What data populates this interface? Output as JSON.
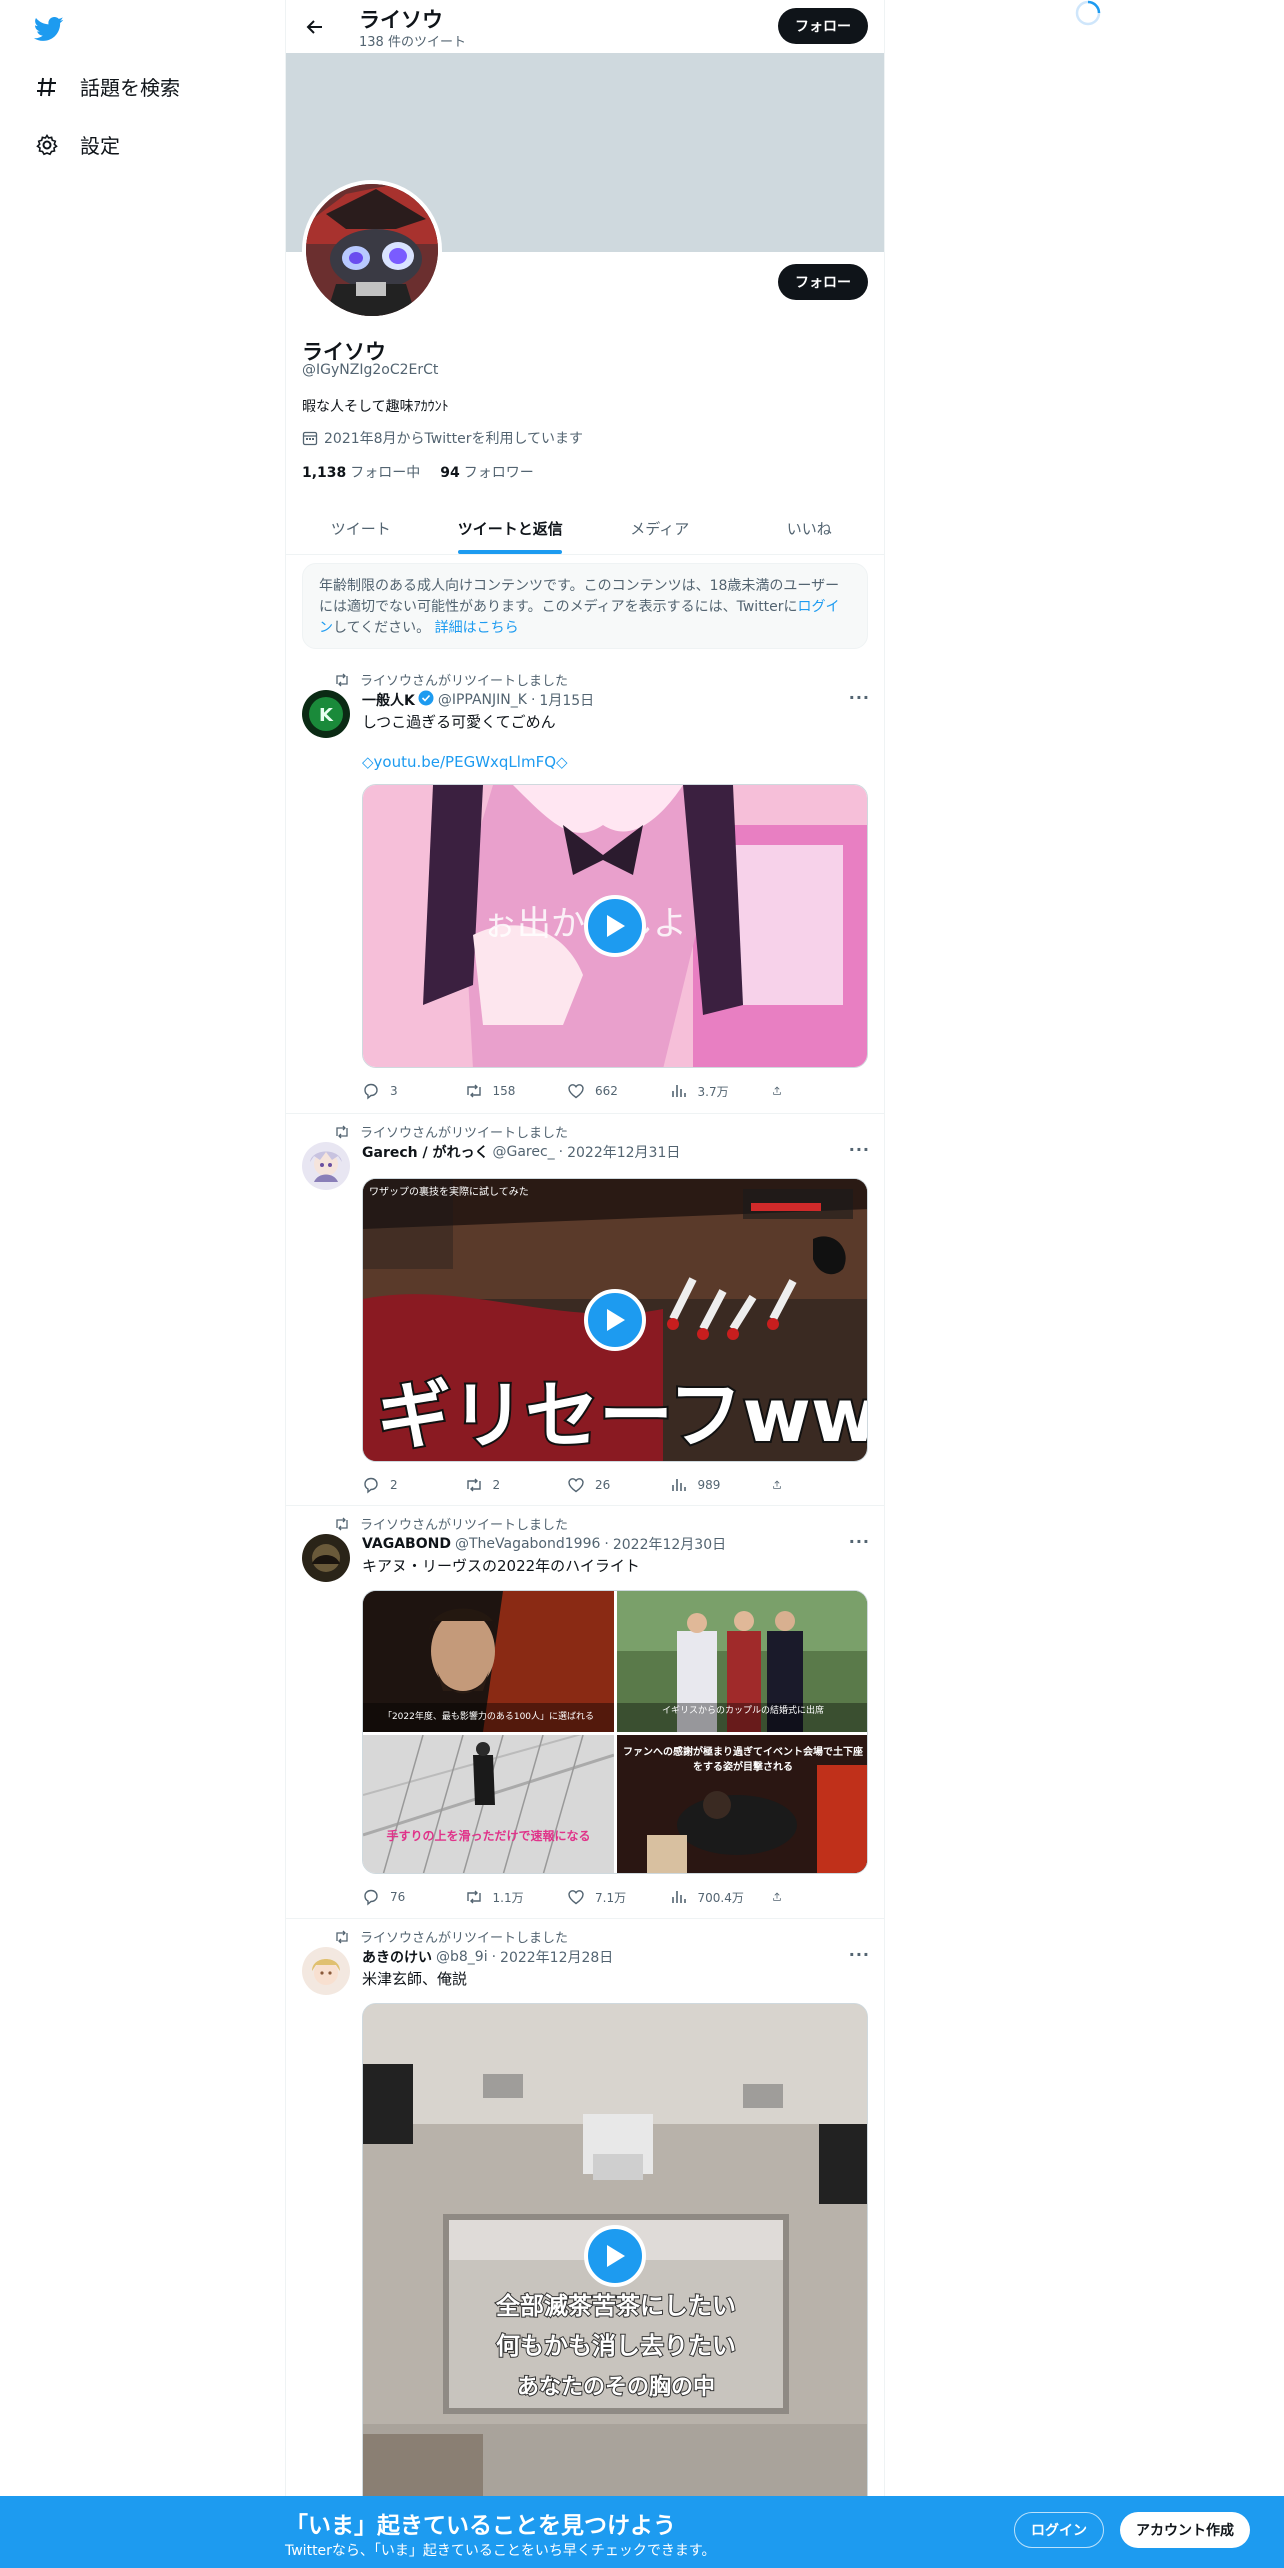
{
  "sidebar": {
    "logo": "twitter-bird-icon",
    "items": [
      {
        "icon": "hashtag-icon",
        "label": "話題を検索"
      },
      {
        "icon": "gear-icon",
        "label": "設定"
      }
    ]
  },
  "header": {
    "name": "ライソウ",
    "tweet_count": "138 件のツイート",
    "follow_label": "フォロー"
  },
  "profile": {
    "name": "ライソウ",
    "handle": "@IGyNZIg2oC2ErCt",
    "bio": "暇な人そして趣味ｱｶｳﾝﾄ",
    "joined": "2021年8月からTwitterを利用しています",
    "following_count": "1,138",
    "following_label": "フォロー中",
    "followers_count": "94",
    "followers_label": "フォロワー",
    "follow_label": "フォロー"
  },
  "tabs": [
    {
      "label": "ツイート",
      "active": false
    },
    {
      "label": "ツイートと返信",
      "active": true
    },
    {
      "label": "メディア",
      "active": false
    },
    {
      "label": "いいね",
      "active": false
    }
  ],
  "notice": {
    "text_before": "年齢制限のある成人向けコンテンツです。このコンテンツは、18歳未満のユーザーには適切でない可能性があります。このメディアを表示するには、Twitterに",
    "login_link": "ログイン",
    "text_after": "してください。",
    "details_link": "詳細はこちら"
  },
  "tweets": [
    {
      "retweet_label": "ライソウさんがリツイートしました",
      "name": "一般人K",
      "handle": "@IPPANJIN_K",
      "date": "1月15日",
      "text": "しつこ過ぎる可愛くてごめん",
      "link": "◇youtu.be/PEGWxqLlmFQ◇",
      "replies": "3",
      "retweets": "158",
      "likes": "662",
      "views": "3.7万"
    },
    {
      "retweet_label": "ライソウさんがリツイートしました",
      "name": "Garech / がれっく",
      "handle": "@Garec_",
      "date": "2022年12月31日",
      "media_text": "ギリセーフwww",
      "media_caption": "ワザップの裏技を実際に試してみた",
      "replies": "2",
      "retweets": "2",
      "likes": "26",
      "views": "989"
    },
    {
      "retweet_label": "ライソウさんがリツイートしました",
      "name": "VAGABOND",
      "handle": "@TheVagabond1996",
      "date": "2022年12月30日",
      "text": "キアヌ・リーヴスの2022年のハイライト",
      "captions": [
        "「2022年度、最も影響力のある100人」に選ばれる",
        "イギリスからのカップルの結婚式に出席",
        "手すりの上を滑っただけで速報になる",
        "ファンへの感謝が極まり過ぎてイベント会場で土下座をする姿が目撃される"
      ],
      "replies": "76",
      "retweets": "1.1万",
      "likes": "7.1万",
      "views": "700.4万"
    },
    {
      "retweet_label": "ライソウさんがリツイートしました",
      "name": "あきのけい",
      "handle": "@b8_9i",
      "date": "2022年12月28日",
      "text": "米津玄師、俺説",
      "lyrics": [
        "全部滅茶苦茶にしたい",
        "何もかも消し去りたい",
        "あなたのその胸の中"
      ]
    }
  ],
  "bottom_bar": {
    "title": "「いま」起きていることを見つけよう",
    "subtitle": "Twitterなら、「いま」起きていることをいち早くチェックできます。",
    "login_label": "ログイン",
    "signup_label": "アカウント作成"
  },
  "colors": {
    "accent": "#1d9bf0",
    "text": "#0f1419",
    "muted": "#536471",
    "banner": "#cfd9de"
  }
}
